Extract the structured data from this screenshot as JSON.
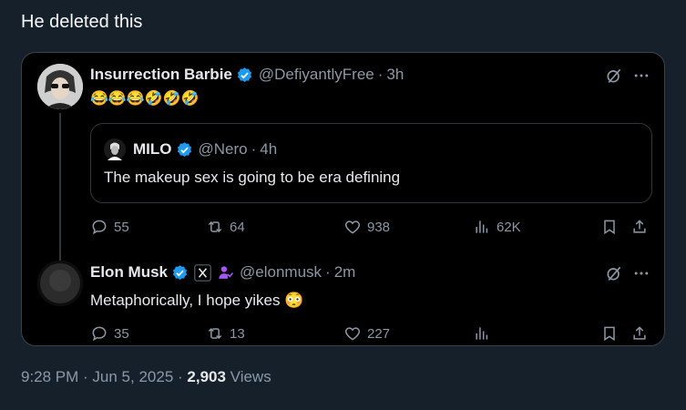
{
  "post_text": "He deleted this",
  "tweet1": {
    "name": "Insurrection Barbie",
    "handle": "@DefiyantlyFree",
    "time": "3h",
    "content": "😂😂😂🤣🤣🤣",
    "quote": {
      "name": "MILO",
      "handle": "@Nero",
      "time": "4h",
      "content": "The makeup sex is going to be era defining"
    },
    "replies": "55",
    "reposts": "64",
    "likes": "938",
    "views": "62K"
  },
  "tweet2": {
    "name": "Elon Musk",
    "handle": "@elonmusk",
    "time": "2m",
    "content": "Metaphorically, I hope yikes 😳",
    "replies": "35",
    "reposts": "13",
    "likes": "227"
  },
  "footer": {
    "timestamp": "9:28 PM · Jun 5, 2025 · ",
    "views_count": "2,903",
    "views_label": " Views"
  },
  "colors": {
    "background": "#15202b",
    "verified": "#1d9bf0",
    "muted": "#8b98a5"
  }
}
